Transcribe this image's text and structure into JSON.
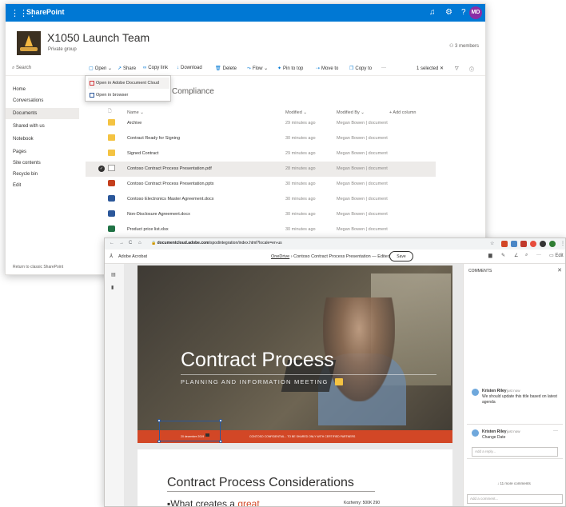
{
  "sharepoint": {
    "brand": "SharePoint",
    "user_initials": "MD",
    "site_title": "X1050 Launch Team",
    "site_subtitle": "Private group",
    "members": "3 members",
    "search": "Search",
    "commands": {
      "open": "Open",
      "share": "Share",
      "copy_link": "Copy link",
      "download": "Download",
      "delete": "Delete",
      "flow": "Flow",
      "pin": "Pin to top",
      "move": "Move to",
      "copy": "Copy to",
      "more": "···",
      "selected": "1 selected"
    },
    "open_menu": [
      "Open in Adobe Document Cloud",
      "Open in browser"
    ],
    "nav": [
      "Home",
      "Conversations",
      "Documents",
      "Shared with us",
      "Notebook",
      "Pages",
      "Site contents",
      "Recycle bin",
      "Edit"
    ],
    "nav_selected": "Documents",
    "return_classic": "Return to classic SharePoint",
    "library_title": "Compliance",
    "columns": {
      "name": "Name",
      "modified": "Modified",
      "modified_by": "Modified By",
      "add": "+ Add column"
    },
    "files": [
      {
        "name": "Archive",
        "type": "folder",
        "modified": "29 minutes ago",
        "by": "Megan Bowen | document"
      },
      {
        "name": "Contract Ready for Signing",
        "type": "folder",
        "modified": "30 minutes ago",
        "by": "Megan Bowen | document"
      },
      {
        "name": "Signed Contract",
        "type": "folder",
        "modified": "29 minutes ago",
        "by": "Megan Bowen | document"
      },
      {
        "name": "Contoso Contract Process Presentation.pdf",
        "type": "pdf",
        "modified": "28 minutes ago",
        "by": "Megan Bowen | document",
        "selected": true
      },
      {
        "name": "Contoso Contract Process Presentation.pptx",
        "type": "pptx",
        "modified": "30 minutes ago",
        "by": "Megan Bowen | document"
      },
      {
        "name": "Contoso Electronics Master Agreement.docx",
        "type": "docx",
        "modified": "30 minutes ago",
        "by": "Megan Bowen | document"
      },
      {
        "name": "Non-Disclosure Agreement.docx",
        "type": "docx",
        "modified": "30 minutes ago",
        "by": "Megan Bowen | document"
      },
      {
        "name": "Product price list.xlsx",
        "type": "xlsx",
        "modified": "30 minutes ago",
        "by": "Megan Bowen | document"
      }
    ]
  },
  "acrobat": {
    "url_host": "documentcloud.adobe.com",
    "url_path": "/spodintegration/index.html?locale=en-us",
    "app_name": "Adobe Acrobat",
    "breadcrumb_link": "OneDrive",
    "breadcrumb_doc": "Contoso Contract Process Presentation",
    "breadcrumb_status": "Edited",
    "save": "Save",
    "edit": "Edit",
    "slide1": {
      "title": "Contract Process",
      "subtitle": "PLANNING AND INFORMATION MEETING",
      "footer_left": "20 decembre 2019",
      "footer_center": "CONTOSO CONFIDENTIAL - TO BE SHARED ONLY WITH CERTIFIED PARTNERS"
    },
    "slide2": {
      "title": "Contract Process Considerations",
      "bullet_prefix": "What creates a ",
      "bullet_accent": "great",
      "side_text": "Kozhemy: 500K 290"
    },
    "comments_header": "COMMENTS",
    "comments": [
      {
        "author": "Kristen Riley",
        "time": "just now",
        "text": "We should update this title based on latest agenda"
      },
      {
        "author": "Kristen Riley",
        "time": "just now",
        "text": "Change Date",
        "reply_placeholder": "Add a reply..."
      }
    ],
    "more_comments": "11 more comments",
    "add_comment": "Add a comment..."
  },
  "colors": {
    "sp_blue": "#0078d4",
    "footer_orange": "#d24726",
    "folder_yellow": "#f4c342"
  }
}
